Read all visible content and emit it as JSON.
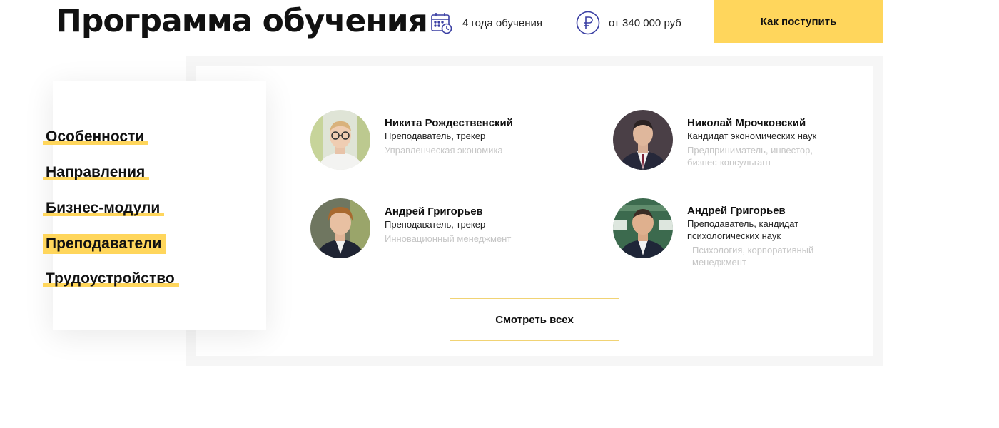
{
  "header": {
    "title": "Программа обучения",
    "duration": {
      "icon": "calendar-clock-icon",
      "text": "4 года обучения"
    },
    "price": {
      "icon": "ruble-icon",
      "text": "от 340 000 руб"
    },
    "apply_label": "Как поступить"
  },
  "nav": {
    "items": [
      {
        "label": "Особенности",
        "active": false
      },
      {
        "label": "Направления",
        "active": false
      },
      {
        "label": "Бизнес-модули",
        "active": false
      },
      {
        "label": "Преподаватели",
        "active": true
      },
      {
        "label": "Трудоустройство",
        "active": false
      }
    ]
  },
  "teachers": [
    {
      "name": "Никита Рождественский",
      "role": "Преподаватель, трекер",
      "field": "Управленческая экономика"
    },
    {
      "name": "Николай Мрочковский",
      "role": "Кандидат экономических наук",
      "field": "Предприниматель, инвестор, бизнес-консультант"
    },
    {
      "name": "Андрей Григорьев",
      "role": "Преподаватель, трекер",
      "field": "Инновационный менеджмент"
    },
    {
      "name": "Андрей Григорьев",
      "role": "Преподаватель, кандидат психологических наук",
      "field": "Психология,  корпоративный менеджмент"
    }
  ],
  "view_all_label": "Смотреть всех",
  "colors": {
    "accent": "#ffd65c",
    "icon": "#3a3fa3",
    "muted_text": "#c6c6c6",
    "panel_bg": "#f6f6f6"
  }
}
